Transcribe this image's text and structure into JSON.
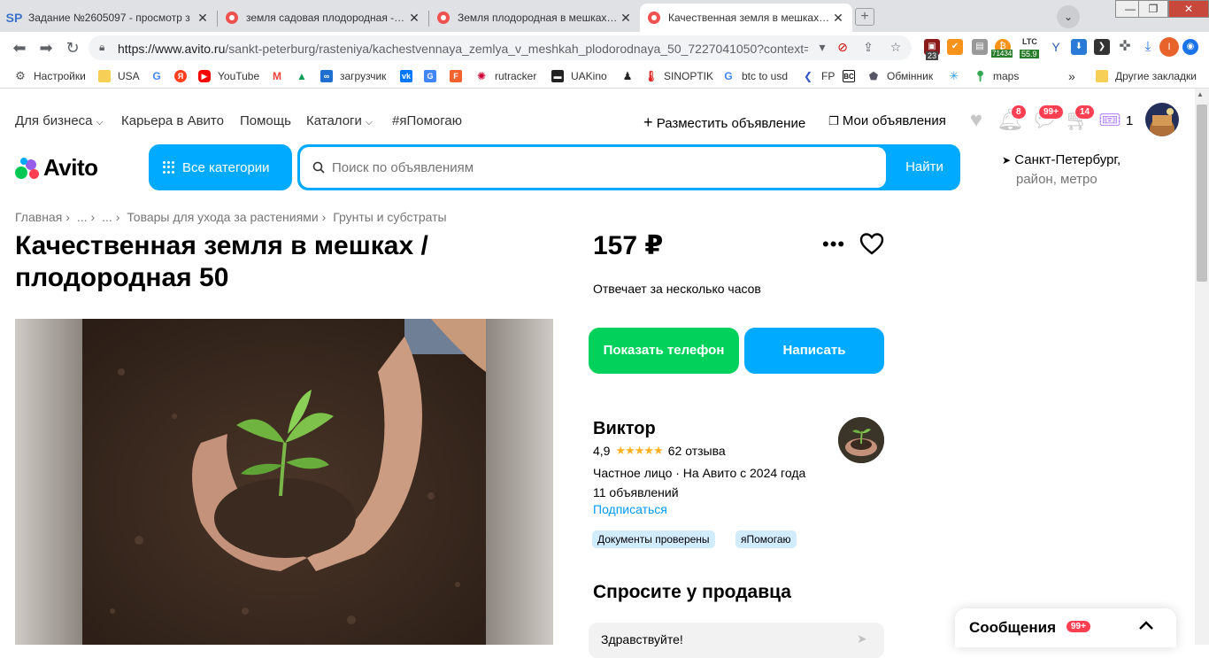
{
  "browser": {
    "tabs": [
      {
        "favicon": "SP",
        "title": "Задание №2605097 - просмотр з",
        "active": false
      },
      {
        "favicon": "avito",
        "title": "земля садовая плодородная - Ку",
        "active": false
      },
      {
        "favicon": "avito",
        "title": "Земля плодородная в мешках. Гр",
        "active": false
      },
      {
        "favicon": "avito",
        "title": "Качественная земля в мешках / п",
        "active": true
      }
    ],
    "url_host": "https://www.avito.ru",
    "url_path": "/sankt-peterburg/rasteniya/kachestvennaya_zemlya_v_meshkah_plodorodnaya_50_7227041050?context=...",
    "ext_counters": {
      "e1": "23",
      "btc": "71434",
      "ltc_label": "LTC",
      "ltc": "55.9",
      "profile": "I"
    },
    "bookmarks": [
      {
        "label": "Настройки",
        "icon": "gear-icon"
      },
      {
        "label": "USA",
        "icon": "folder-icon"
      },
      {
        "label": "",
        "icon": "google-icon"
      },
      {
        "label": "",
        "icon": "yandex-icon"
      },
      {
        "label": "YouTube",
        "icon": "youtube-icon"
      },
      {
        "label": "",
        "icon": "gmail-icon"
      },
      {
        "label": "",
        "icon": "drive-icon"
      },
      {
        "label": "загрузчик",
        "icon": "infinity-icon"
      },
      {
        "label": "",
        "icon": "vk-icon"
      },
      {
        "label": "",
        "icon": "translate-icon"
      },
      {
        "label": "",
        "icon": "f-icon"
      },
      {
        "label": "rutracker",
        "icon": "rutracker-icon"
      },
      {
        "label": "UAKino",
        "icon": "uakino-icon"
      },
      {
        "label": "",
        "icon": "figure-icon"
      },
      {
        "label": "SINOPTIK",
        "icon": "thermometer-icon"
      },
      {
        "label": "btc to usd",
        "icon": "google-icon"
      },
      {
        "label": "FP",
        "icon": "fp-icon"
      },
      {
        "label": "",
        "icon": "bc-icon"
      },
      {
        "label": "Обмінник",
        "icon": "exchange-icon"
      },
      {
        "label": "",
        "icon": "star-icon"
      },
      {
        "label": "maps",
        "icon": "maps-icon"
      },
      {
        "label": "»",
        "icon": ""
      },
      {
        "label": "Другие закладки",
        "icon": "folder-icon"
      }
    ]
  },
  "header": {
    "nav": [
      "Для бизнеса",
      "Карьера в Авито",
      "Помощь",
      "Каталоги",
      "#яПомогаю"
    ],
    "post_ad": "Разместить объявление",
    "my_ads": "Мои объявления",
    "badges": {
      "notifications": "8",
      "messages": "99+",
      "cart": "14",
      "promo": "1"
    },
    "logo_text": "Avito",
    "all_categories": "Все категории",
    "search_placeholder": "Поиск по объявлениям",
    "search_button": "Найти",
    "location_city": "Санкт-Петербург,",
    "location_sub": "район, метро"
  },
  "breadcrumbs": [
    "Главная",
    "...",
    "...",
    "Товары для ухода за растениями",
    "Грунты и субстраты"
  ],
  "listing": {
    "title": "Качественная земля в мешках / плодородная 50",
    "price": "157 ₽",
    "response_time": "Отвечает за несколько часов",
    "show_phone": "Показать телефон",
    "write": "Написать"
  },
  "seller": {
    "name": "Виктор",
    "rating": "4,9",
    "stars": 4.9,
    "reviews": "62 отзыва",
    "type": "Частное лицо · На Авито с 2024 года",
    "ads_count": "11 объявлений",
    "subscribe": "Подписаться",
    "tags": [
      "Документы проверены",
      "яПомогаю"
    ]
  },
  "ask": {
    "title": "Спросите у продавца",
    "input_value": "Здравствуйте!"
  },
  "messages_panel": {
    "label": "Сообщения",
    "count": "99+"
  },
  "colors": {
    "accent_blue": "#00aaff",
    "phone_green": "#02d15c",
    "badge_red": "#ff4053",
    "link_blue": "#0099f7",
    "tag_blue": "#d2ecff"
  }
}
